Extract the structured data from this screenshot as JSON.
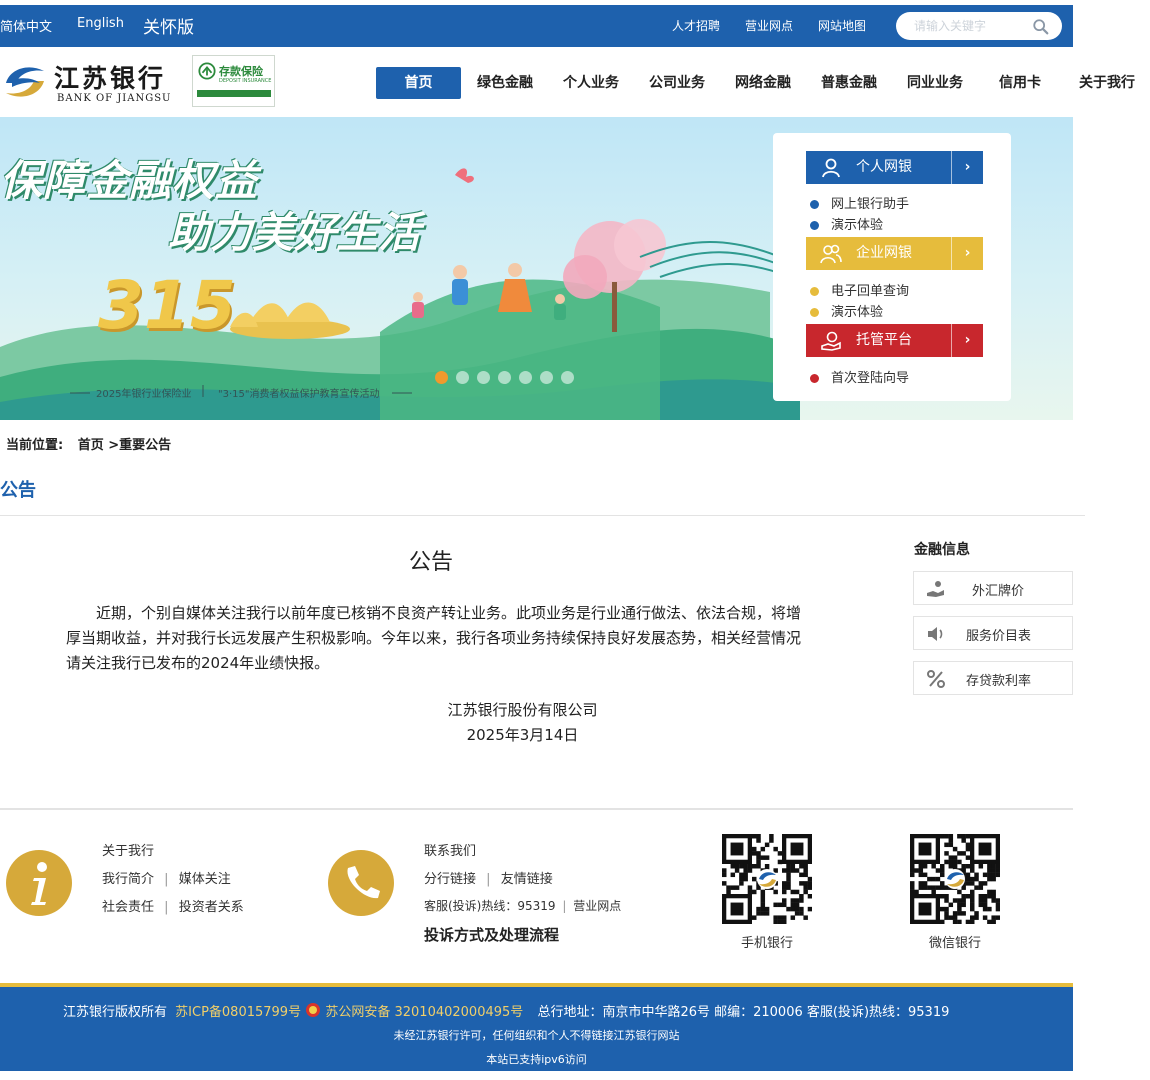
{
  "topbar": {
    "lang_cn": "简体中文",
    "lang_en": "English",
    "care_mode": "关怀版",
    "links": [
      "人才招聘",
      "营业网点",
      "网站地图"
    ],
    "search_placeholder": "请输入关键字"
  },
  "brand": {
    "name_cn": "江苏银行",
    "name_en": "BANK OF JIANGSU",
    "deposit_cn": "存款保险",
    "deposit_en": "DEPOSIT INSURANCE"
  },
  "nav": [
    "首页",
    "绿色金融",
    "个人业务",
    "公司业务",
    "网络金融",
    "普惠金融",
    "同业业务",
    "信用卡",
    "关于我行"
  ],
  "banner": {
    "title_line1": "保障金融权益",
    "title_line2": "助力美好生活",
    "number": "315",
    "footer_left": "2025年银行业保险业",
    "footer_right": "\"3·15\"消费者权益保护教育宣传活动",
    "slide_count": 7,
    "active_slide": 1
  },
  "login_panel": {
    "personal": {
      "label": "个人网银",
      "links": [
        "网上银行助手",
        "演示体验"
      ]
    },
    "corporate": {
      "label": "企业网银",
      "links": [
        "电子回单查询",
        "演示体验"
      ]
    },
    "custody": {
      "label": "托管平台",
      "links": [
        "首次登陆向导"
      ]
    },
    "arrow": "›",
    "colors": {
      "blue": "#1e61ad",
      "gold": "#e6bc3c",
      "red": "#c8272d"
    }
  },
  "breadcrumb": {
    "prefix": "当前位置:",
    "path": "首页 >重要公告"
  },
  "section_title": "公告",
  "article": {
    "title": "公告",
    "body": "近期，个别自媒体关注我行以前年度已核销不良资产转让业务。此项业务是行业通行做法、依法合规，将增厚当期收益，并对我行长远发展产生积极影响。今年以来，我行各项业务持续保持良好发展态势，相关经营情况请关注我行已发布的2024年业绩快报。",
    "signature": "江苏银行股份有限公司",
    "date": "2025年3月14日"
  },
  "side": {
    "title": "金融信息",
    "items": [
      "外汇牌价",
      "服务价目表",
      "存贷款利率"
    ]
  },
  "footer": {
    "about_title": "关于我行",
    "about_row1": [
      "我行简介",
      "媒体关注"
    ],
    "about_row2": [
      "社会责任",
      "投资者关系"
    ],
    "contact_title": "联系我们",
    "contact_row1": [
      "分行链接",
      "友情链接"
    ],
    "hotline": "客服(投诉)热线：95319",
    "branches": "营业网点",
    "complaint": "投诉方式及处理流程",
    "qr_mobile": "手机银行",
    "qr_wechat": "微信银行",
    "sep": "|"
  },
  "bottom": {
    "copyright": "江苏银行版权所有",
    "icp": "苏ICP备08015799号",
    "police": "苏公网安备 32010402000495号",
    "address": "总行地址：南京市中华路26号 邮编：210006 客服(投诉)热线：95319",
    "notice": "未经江苏银行许可，任何组织和个人不得链接江苏银行网站",
    "ipv6": "本站已支持ipv6访问"
  }
}
